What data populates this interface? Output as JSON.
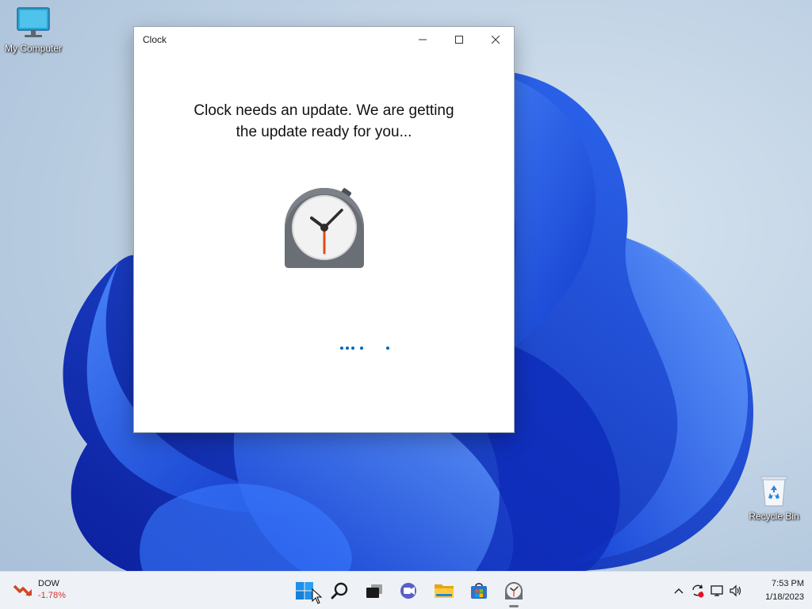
{
  "desktop": {
    "icons": [
      {
        "label": "My Computer",
        "icon": "computer-monitor-icon"
      },
      {
        "label": "Recycle Bin",
        "icon": "recycle-bin-icon"
      }
    ]
  },
  "window": {
    "title": "Clock",
    "message": "Clock needs an update. We are getting the update ready for you...",
    "app_icon": "clock-app-icon"
  },
  "taskbar": {
    "widget": {
      "name": "DOW",
      "change": "-1.78%",
      "change_color": "#d13438"
    },
    "apps": [
      "start-icon",
      "search-icon",
      "task-view-icon",
      "chat-icon",
      "file-explorer-icon",
      "store-icon",
      "clock-app-icon"
    ],
    "tray": [
      "show-hidden-icons-chevron",
      "sync-icon",
      "network-icon",
      "volume-icon"
    ],
    "time": "7:53 PM",
    "date": "1/18/2023"
  },
  "colors": {
    "accent": "#0067c0",
    "wallpaper_blue": "#1a56e0",
    "taskbar_bg": "#eef1f5"
  }
}
